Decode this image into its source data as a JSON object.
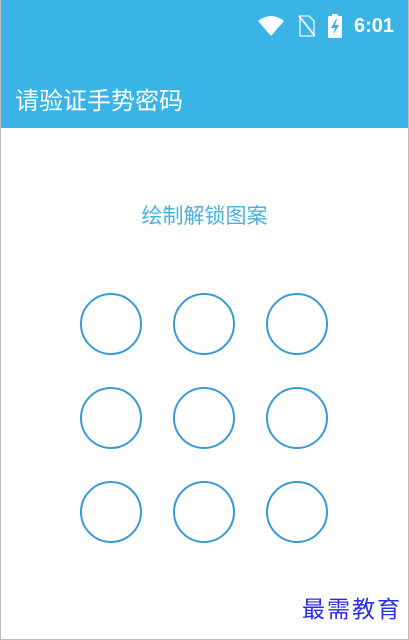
{
  "status_bar": {
    "icons": [
      "wifi-icon",
      "no-sim-icon",
      "battery-charging-icon"
    ],
    "time": "6:01",
    "background": "#3ab4e6"
  },
  "app_bar": {
    "title": "请验证手势密码",
    "background": "#3ab4e6"
  },
  "pattern": {
    "hint": "绘制解锁图案",
    "hint_color": "#4ab0dc",
    "dot_color": "#3a9bd3",
    "rows": 3,
    "cols": 3
  },
  "watermark": {
    "text": "最需教育"
  }
}
